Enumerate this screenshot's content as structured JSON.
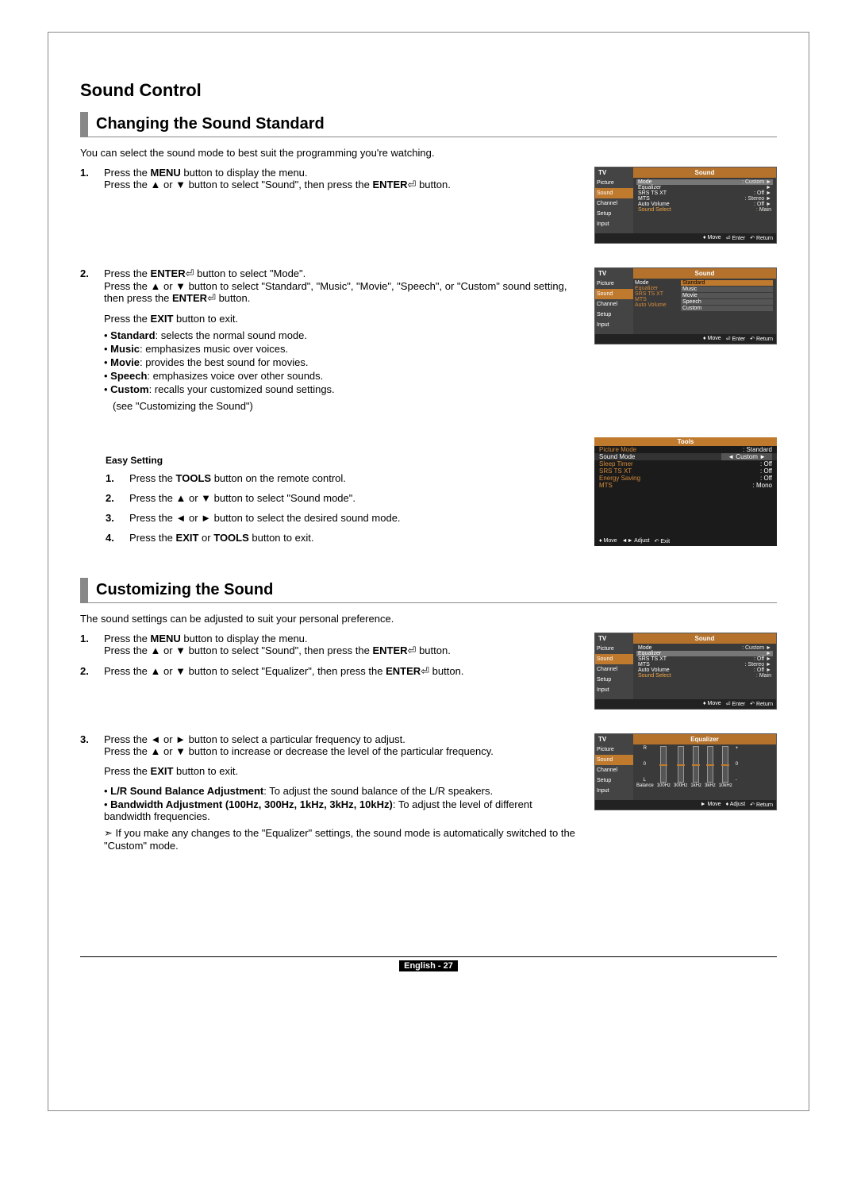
{
  "section_title": "Sound Control",
  "s1": {
    "heading": "Changing the Sound Standard",
    "intro": "You can select the sound mode to best suit the programming you're watching.",
    "step1a": "Press the ",
    "step1a_btn": "MENU",
    "step1a_end": " button to display the menu.",
    "step1b": "Press the ▲ or ▼ button to select \"Sound\", then press the ",
    "step1b_btn": "ENTER",
    "step1b_end": " button.",
    "step2a": "Press the ",
    "step2a_btn": "ENTER",
    "step2a_end": " button to select \"Mode\".",
    "step2b": "Press the ▲ or ▼ button to select \"Standard\", \"Music\", \"Movie\", \"Speech\", or \"Custom\" sound setting, then press the ",
    "step2b_btn": "ENTER",
    "step2b_end": " button.",
    "exit": "Press the ",
    "exit_btn": "EXIT",
    "exit_end": " button to exit.",
    "modes": {
      "standard_t": "Standard",
      "standard_d": ": selects the normal sound mode.",
      "music_t": "Music",
      "music_d": ": emphasizes music over voices.",
      "movie_t": "Movie",
      "movie_d": ": provides the best sound for movies.",
      "speech_t": "Speech",
      "speech_d": ": emphasizes voice over other sounds.",
      "custom_t": "Custom",
      "custom_d": ": recalls your customized sound settings.",
      "custom_note": "(see \"Customizing the Sound\")"
    },
    "easy_heading": "Easy Setting",
    "easy1": "Press the ",
    "easy1_btn": "TOOLS",
    "easy1_end": " button on the remote control.",
    "easy2": "Press the ▲ or ▼ button to select \"Sound mode\".",
    "easy3": "Press the ◄ or ► button to select the desired sound mode.",
    "easy4": "Press the ",
    "easy4_btn": "EXIT",
    "easy4_mid": " or ",
    "easy4_btn2": "TOOLS",
    "easy4_end": " button to exit."
  },
  "s2": {
    "heading": "Customizing the Sound",
    "intro": "The sound settings can be adjusted to suit your personal preference.",
    "step1a": "Press the ",
    "step1a_btn": "MENU",
    "step1a_end": " button to display the menu.",
    "step1b": "Press the ▲ or ▼ button to select \"Sound\", then press the ",
    "step1b_btn": "ENTER",
    "step1b_end": " button.",
    "step2": "Press the ▲ or ▼ button to select \"Equalizer\", then press the ",
    "step2_btn": "ENTER",
    "step2_end": " button.",
    "step3a": "Press the ◄ or ► button to select a particular frequency to adjust.",
    "step3b": "Press the ▲ or ▼ button to increase or decrease the level of the particular frequency.",
    "exit": "Press the ",
    "exit_btn": "EXIT",
    "exit_end": " button to exit.",
    "lr_t": "L/R Sound Balance Adjustment",
    "lr_d": ": To adjust the sound balance of the L/R speakers.",
    "bw_t": "Bandwidth Adjustment (100Hz, 300Hz, 1kHz, 3kHz, 10kHz)",
    "bw_d": ": To adjust the level of different bandwidth frequencies.",
    "note": "If you make any changes to the \"Equalizer\" settings, the sound mode is automatically switched to the \"Custom\" mode."
  },
  "osd_sound": {
    "tv": "TV",
    "title": "Sound",
    "rows": {
      "mode_l": "Mode",
      "mode_v": "Custom",
      "eq_l": "Equalizer",
      "eq_v": "",
      "srs_l": "SRS TS XT",
      "srs_v": "Off",
      "mts_l": "MTS",
      "mts_v": "Stereo",
      "av_l": "Auto Volume",
      "av_v": "Off",
      "ss_l": "Sound Select",
      "ss_v": "Main"
    },
    "nav": {
      "picture": "Picture",
      "sound": "Sound",
      "channel": "Channel",
      "setup": "Setup",
      "input": "Input"
    },
    "foot": {
      "move": "Move",
      "enter": "Enter",
      "return": "Return",
      "adjust": "Adjust",
      "exit": "Exit"
    }
  },
  "osd_mode_opts": {
    "title": "Sound",
    "mode": "Mode",
    "o1": "Standard",
    "o2": "Music",
    "o3": "Movie",
    "o4": "Speech",
    "o5": "Custom",
    "labels": {
      "eq": "Equalizer",
      "srs": "SRS TS XT",
      "mts": "MTS",
      "av": "Auto Volume"
    }
  },
  "tools": {
    "title": "Tools",
    "pm_l": "Picture Mode",
    "pm_v": "Standard",
    "sm_l": "Sound Mode",
    "sm_v": "Custom",
    "st_l": "Sleep Timer",
    "st_v": "Off",
    "srs_l": "SRS TS XT",
    "srs_v": "Off",
    "es_l": "Energy Saving",
    "es_v": "Off",
    "mts_l": "MTS",
    "mts_v": "Mono"
  },
  "eq": {
    "title": "Equalizer",
    "balance": "Balance",
    "b1": "100Hz",
    "b2": "300Hz",
    "b3": "1kHz",
    "b4": "3kHz",
    "b5": "10kHz",
    "r": "R",
    "l": "L",
    "plus": "+",
    "zero": "0"
  },
  "footer": {
    "lang": "English -",
    "page": "27"
  }
}
